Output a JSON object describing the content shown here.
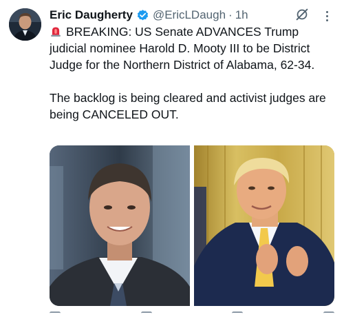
{
  "tweet": {
    "author_name": "Eric Daugherty",
    "handle": "@EricLDaugh",
    "separator": "·",
    "time": "1h",
    "text_line1": "BREAKING: US Senate ADVANCES Trump judicial nominee Harold D. Mooty III to be District Judge for the Northern District of Alabama, 62-34.",
    "text_line2": "The backlog is being cleared and activist judges are being CANCELED OUT.",
    "leading_emoji": "siren-icon"
  },
  "media": {
    "photos": [
      {
        "name": "photo-nominee",
        "description_icon": "portrait"
      },
      {
        "name": "photo-trump",
        "description_icon": "portrait"
      }
    ]
  },
  "colors": {
    "verified": "#1d9bf0",
    "secondary_text": "#536471",
    "primary_text": "#0f1419"
  },
  "icons": [
    "verified-badge-icon",
    "grok-icon",
    "more-options-icon",
    "siren-icon"
  ]
}
